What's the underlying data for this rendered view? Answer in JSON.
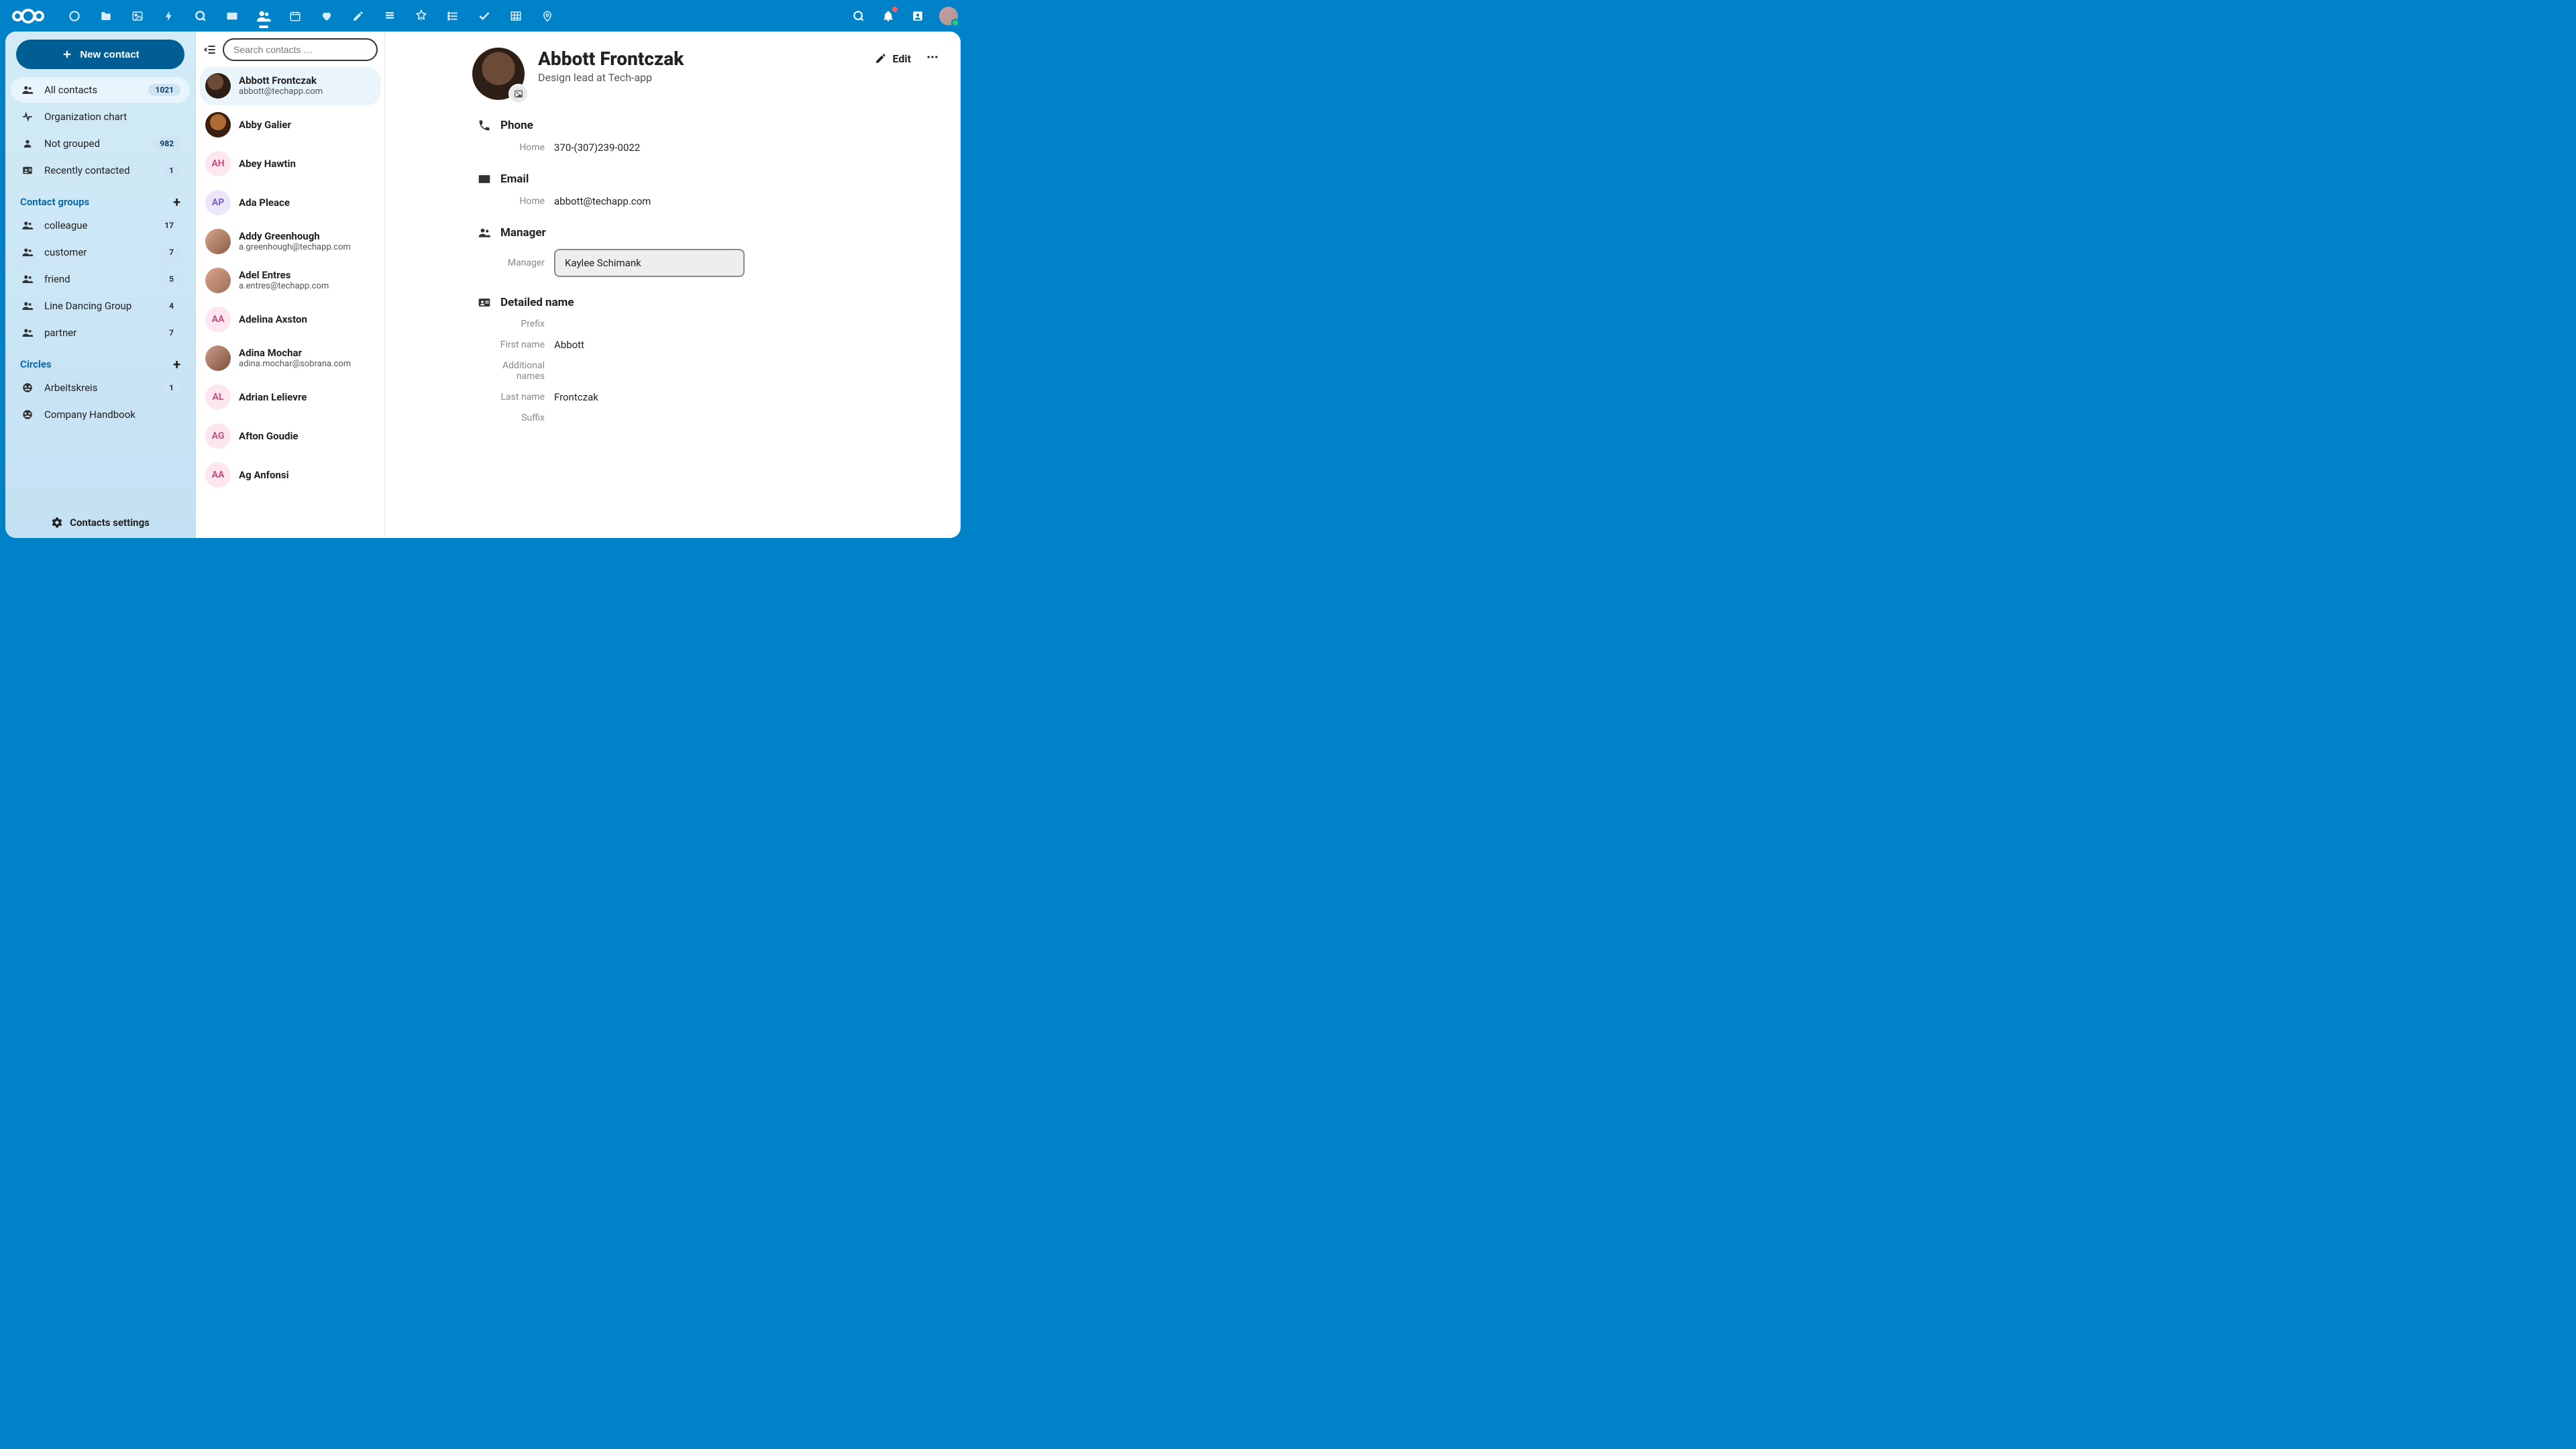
{
  "newContactLabel": "New contact",
  "search": {
    "placeholder": "Search contacts …"
  },
  "nav": {
    "allContacts": {
      "label": "All contacts",
      "count": "1021"
    },
    "orgChart": {
      "label": "Organization chart"
    },
    "notGrouped": {
      "label": "Not grouped",
      "count": "982"
    },
    "recent": {
      "label": "Recently contacted",
      "count": "1"
    }
  },
  "sections": {
    "groupsTitle": "Contact groups",
    "circlesTitle": "Circles"
  },
  "groups": [
    {
      "label": "colleague",
      "count": "17"
    },
    {
      "label": "customer",
      "count": "7"
    },
    {
      "label": "friend",
      "count": "5"
    },
    {
      "label": "Line Dancing Group",
      "count": "4"
    },
    {
      "label": "partner",
      "count": "7"
    }
  ],
  "circles": [
    {
      "label": "Arbeitskreis",
      "count": "1"
    },
    {
      "label": "Company Handbook"
    }
  ],
  "settingsLabel": "Contacts settings",
  "contacts": [
    {
      "name": "Abbott Frontczak",
      "sub": "abbott@techapp.com",
      "avatar": "photo",
      "selected": true
    },
    {
      "name": "Abby Galier",
      "avatar": "photo"
    },
    {
      "name": "Abey Hawtin",
      "initials": "AH",
      "avatar": "pink"
    },
    {
      "name": "Ada Pleace",
      "initials": "AP",
      "avatar": "lilac"
    },
    {
      "name": "Addy Greenhough",
      "sub": "a.greenhough@techapp.com",
      "avatar": "photo"
    },
    {
      "name": "Adel Entres",
      "sub": "a.entres@techapp.com",
      "avatar": "photo"
    },
    {
      "name": "Adelina Axston",
      "initials": "AA",
      "avatar": "pink"
    },
    {
      "name": "Adina Mochar",
      "sub": "adina.mochar@sobrana.com",
      "avatar": "photo"
    },
    {
      "name": "Adrian Lelievre",
      "initials": "AL",
      "avatar": "pink"
    },
    {
      "name": "Afton Goudie",
      "initials": "AG",
      "avatar": "pink"
    },
    {
      "name": "Ag Anfonsi",
      "initials": "AA",
      "avatar": "pink"
    }
  ],
  "detail": {
    "name": "Abbott Frontczak",
    "subtitle": "Design lead at Tech-app",
    "editLabel": "Edit",
    "sections": {
      "phone": {
        "title": "Phone",
        "rows": [
          {
            "k": "Home",
            "v": "370-(307)239-0022"
          }
        ]
      },
      "email": {
        "title": "Email",
        "rows": [
          {
            "k": "Home",
            "v": "abbott@techapp.com"
          }
        ]
      },
      "manager": {
        "title": "Manager",
        "label": "Manager",
        "value": "Kaylee Schimank"
      },
      "detailedName": {
        "title": "Detailed name",
        "rows": [
          {
            "k": "Prefix",
            "v": ""
          },
          {
            "k": "First name",
            "v": "Abbott"
          },
          {
            "k": "Additional names",
            "v": ""
          },
          {
            "k": "Last name",
            "v": "Frontczak"
          },
          {
            "k": "Suffix",
            "v": ""
          }
        ]
      }
    }
  }
}
